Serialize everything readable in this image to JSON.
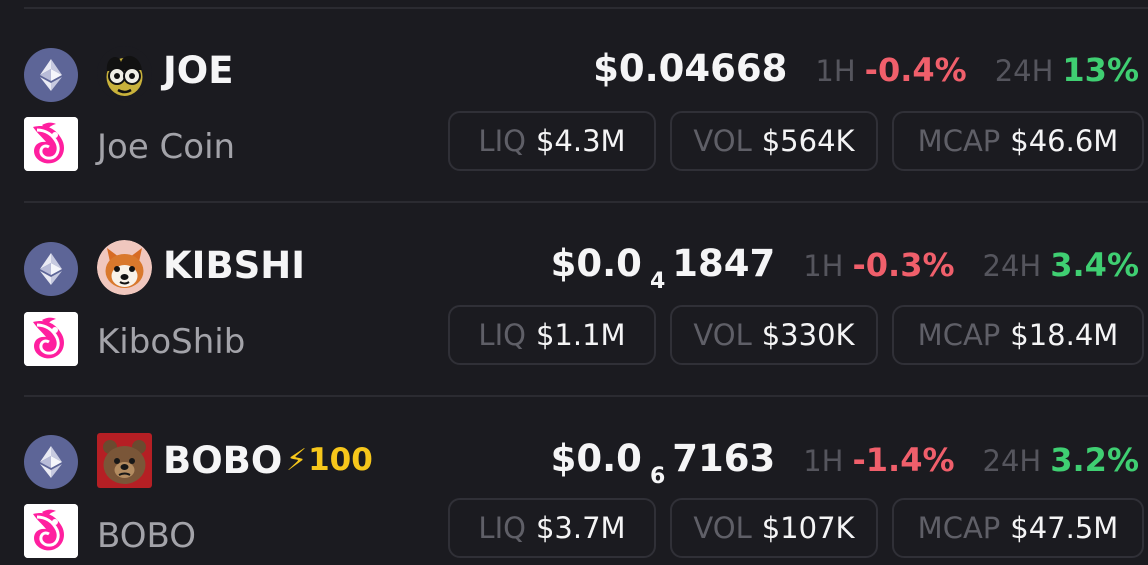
{
  "tokens": [
    {
      "symbol": "JOE",
      "name": "Joe Coin",
      "price_main": "$0.04668",
      "price_tail": "",
      "price_zero_count": "",
      "change_1h_label": "1H",
      "change_1h": "-0.4%",
      "change_24h_label": "24H",
      "change_24h": "13%",
      "stats": {
        "liq_label": "LIQ",
        "liq": "$4.3M",
        "vol_label": "VOL",
        "vol": "$564K",
        "mcap_label": "MCAP",
        "mcap": "$46.6M"
      },
      "chain_icon": "ethereum-icon",
      "token_icon": "joe-token-icon",
      "dex_icon": "uniswap-icon"
    },
    {
      "symbol": "KIBSHI",
      "name": "KiboShib",
      "price_main": "$0.0",
      "price_zero_count": "4",
      "price_tail": "1847",
      "change_1h_label": "1H",
      "change_1h": "-0.3%",
      "change_24h_label": "24H",
      "change_24h": "3.4%",
      "stats": {
        "liq_label": "LIQ",
        "liq": "$1.1M",
        "vol_label": "VOL",
        "vol": "$330K",
        "mcap_label": "MCAP",
        "mcap": "$18.4M"
      },
      "chain_icon": "ethereum-icon",
      "token_icon": "shiba-token-icon",
      "dex_icon": "uniswap-icon"
    },
    {
      "symbol": "BOBO",
      "boost": "100",
      "name": "BOBO",
      "price_main": "$0.0",
      "price_zero_count": "6",
      "price_tail": "7163",
      "change_1h_label": "1H",
      "change_1h": "-1.4%",
      "change_24h_label": "24H",
      "change_24h": "3.2%",
      "stats": {
        "liq_label": "LIQ",
        "liq": "$3.7M",
        "vol_label": "VOL",
        "vol": "$107K",
        "mcap_label": "MCAP",
        "mcap": "$47.5M"
      },
      "chain_icon": "ethereum-icon",
      "token_icon": "bear-token-icon",
      "dex_icon": "uniswap-icon"
    }
  ],
  "colors": {
    "background": "#1b1b20",
    "divider": "#2b2b31",
    "text_primary": "#f5f5f6",
    "text_secondary": "#a3a3a9",
    "muted": "#55555d",
    "negative": "#f05f6b",
    "positive": "#3fcf72",
    "boost": "#f7c71b",
    "ethereum": "#5d6597",
    "uniswap": "#ff1493"
  }
}
